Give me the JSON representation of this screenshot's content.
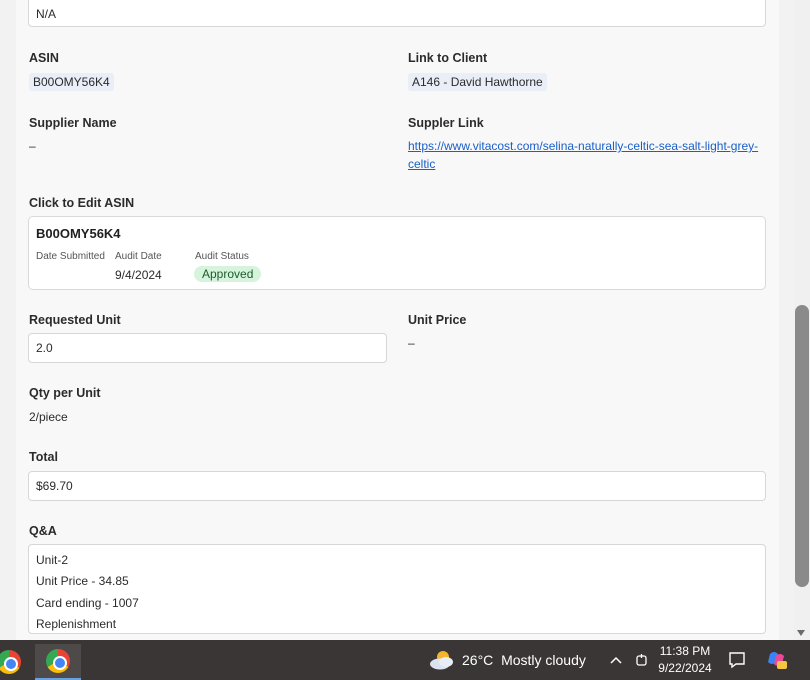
{
  "form": {
    "top_value": "N/A",
    "asin_label": "ASIN",
    "asin_value": "B00OMY56K4",
    "link_client_label": "Link to Client",
    "link_client_value": "A146 - David Hawthorne",
    "supplier_name_label": "Supplier Name",
    "supplier_name_value": "–",
    "supplier_link_label": "Suppler Link",
    "supplier_link_value": "https://www.vitacost.com/selina-naturally-celtic-sea-salt-light-grey-celtic",
    "edit_asin_label": "Click to Edit ASIN",
    "card": {
      "asin": "B00OMY56K4",
      "date_submitted_label": "Date Submitted",
      "audit_date_label": "Audit Date",
      "audit_date_value": "9/4/2024",
      "audit_status_label": "Audit Status",
      "audit_status_value": "Approved"
    },
    "requested_unit_label": "Requested Unit",
    "requested_unit_value": "2.0",
    "unit_price_label": "Unit Price",
    "unit_price_value": "–",
    "qty_per_unit_label": "Qty per Unit",
    "qty_per_unit_value": "2/piece",
    "total_label": "Total",
    "total_value": "$69.70",
    "qa_label": "Q&A",
    "qa_lines": [
      "Unit-2",
      "Unit Price - 34.85",
      "Card ending - 1007",
      "Replenishment"
    ]
  },
  "taskbar": {
    "weather_temp": "26°C",
    "weather_text": "Mostly cloudy",
    "time": "11:38 PM",
    "date": "9/22/2024"
  },
  "colors": {
    "link": "#1a5fc9",
    "approved_bg": "#d6f3dc",
    "taskbar_bg": "#3a3635"
  }
}
